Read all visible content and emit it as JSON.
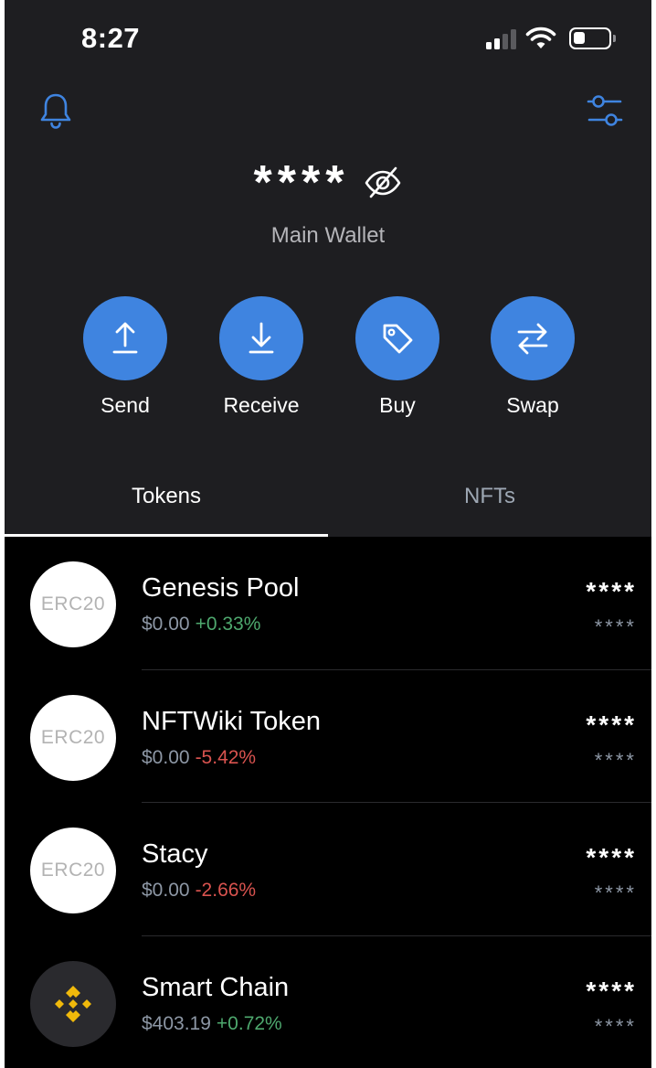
{
  "status_bar": {
    "time": "8:27"
  },
  "header": {
    "balance": "****",
    "wallet_name": "Main Wallet"
  },
  "actions": [
    {
      "label": "Send",
      "icon": "arrow-up-icon"
    },
    {
      "label": "Receive",
      "icon": "arrow-down-icon"
    },
    {
      "label": "Buy",
      "icon": "tag-icon"
    },
    {
      "label": "Swap",
      "icon": "swap-arrows-icon"
    }
  ],
  "tabs": [
    {
      "label": "Tokens",
      "active": true
    },
    {
      "label": "NFTs",
      "active": false
    }
  ],
  "tokens": [
    {
      "logo_text": "ERC20",
      "name": "Genesis Pool",
      "price": "$0.00",
      "change": "+0.33%",
      "direction": "up",
      "amount": "****",
      "fiat": "****"
    },
    {
      "logo_text": "ERC20",
      "name": "NFTWiki Token",
      "price": "$0.00",
      "change": "-5.42%",
      "direction": "down",
      "amount": "****",
      "fiat": "****"
    },
    {
      "logo_text": "ERC20",
      "name": "Stacy",
      "price": "$0.00",
      "change": "-2.66%",
      "direction": "down",
      "amount": "****",
      "fiat": "****"
    },
    {
      "logo_text": "",
      "logo_icon": "bnb-logo-icon",
      "name": "Smart Chain",
      "price": "$403.19",
      "change": "+0.72%",
      "direction": "up",
      "amount": "****",
      "fiat": "****"
    }
  ],
  "colors": {
    "accent": "#3f84e0",
    "header_bg": "#1e1e21",
    "list_bg": "#000000",
    "positive": "#4ea86e",
    "negative": "#d9534f",
    "bnb_yellow": "#f0b90b"
  }
}
